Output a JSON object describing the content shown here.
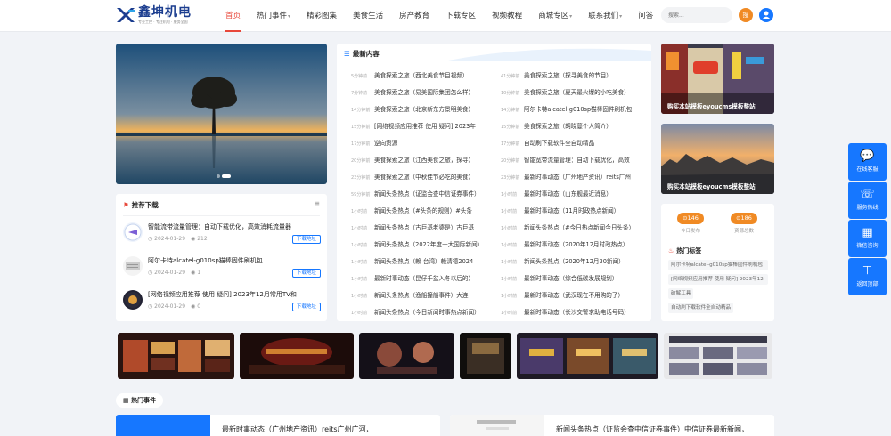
{
  "brand": {
    "title": "鑫坤机电",
    "sub": "专业工控 · 专注机电 · 服务全国"
  },
  "nav": [
    {
      "label": "首页",
      "active": true,
      "caret": false
    },
    {
      "label": "热门事件",
      "caret": true
    },
    {
      "label": "精彩图集",
      "caret": false
    },
    {
      "label": "美食生活",
      "caret": false
    },
    {
      "label": "房产教育",
      "caret": false
    },
    {
      "label": "下载专区",
      "caret": false
    },
    {
      "label": "视频教程",
      "caret": false
    },
    {
      "label": "商城专区",
      "caret": true
    },
    {
      "label": "联系我们",
      "caret": true
    },
    {
      "label": "问答",
      "caret": false
    }
  ],
  "search": {
    "placeholder": "搜索..."
  },
  "header_icons": {
    "orange": "搜",
    "blue": "user-icon"
  },
  "recommend": {
    "title": "推荐下载",
    "btn_label": "下载地址",
    "items": [
      {
        "title": "智能流带流量管理：自动下载优化，高效消耗流量器",
        "date": "2024-01-29",
        "views": "212"
      },
      {
        "title": "阿尔卡特alcatel-g010sp猫棒固件刷机包",
        "date": "2024-01-29",
        "views": "1"
      },
      {
        "title": "[网络视频应用推荐 使用 疑问] 2023年12月常用TV和",
        "date": "2024-01-29",
        "views": "0"
      }
    ]
  },
  "latest": {
    "title": "最新内容",
    "left": [
      {
        "time": "5分钟前",
        "text": "美食探索之旅（西北美食节目视频）"
      },
      {
        "time": "7分钟前",
        "text": "美食探索之旅（易美国际集团怎么样）"
      },
      {
        "time": "14分钟前",
        "text": "美食探索之旅（北京新东方景明美食）"
      },
      {
        "time": "15分钟前",
        "text": "[网络视频应用推荐 使用 疑问] 2023年"
      },
      {
        "time": "17分钟前",
        "text": "逆向资源"
      },
      {
        "time": "20分钟前",
        "text": "美食探索之旅（江西美食之旅，探寻）"
      },
      {
        "time": "23分钟前",
        "text": "美食探索之旅（中秋佳节必吃的美食）"
      },
      {
        "time": "59分钟前",
        "text": "新闻头条热点（证监会查中信证券事件）"
      },
      {
        "time": "1小时前",
        "text": "新闻头条热点（#头条的规则）#头条"
      },
      {
        "time": "1小时前",
        "text": "新闻头条热点（古巨基老婆是）古巨基"
      },
      {
        "time": "1小时前",
        "text": "新闻头条热点（2022年度十大国际新闻）"
      },
      {
        "time": "1小时前",
        "text": "新闻头条热点（赖 台湾）赖清德2024"
      },
      {
        "time": "1小时前",
        "text": "最新时事动态（昆仔千盆入冬以后的）"
      },
      {
        "time": "1小时前",
        "text": "新闻头条热点（渔船撞船事件）大连"
      },
      {
        "time": "1小时前",
        "text": "新闻头条热点（今日新闻时事热点新闻）"
      }
    ],
    "right": [
      {
        "time": "41分钟前",
        "text": "美食探索之旅（探寻美食的节目）"
      },
      {
        "time": "10分钟前",
        "text": "美食探索之旅（夏天最火爆的小吃美食）"
      },
      {
        "time": "14分钟前",
        "text": "阿尔卡特alcatel-g010sp猫棒固件刷机包"
      },
      {
        "time": "15分钟前",
        "text": "美食探索之旅（胡晓蔓个人简介）"
      },
      {
        "time": "17分钟前",
        "text": "自动刷下载软件全自动精品"
      },
      {
        "time": "20分钟前",
        "text": "智能宽带流量管理：自动下载优化，高效"
      },
      {
        "time": "23分钟前",
        "text": "最新时事动态（广州地产资讯）reits广州"
      },
      {
        "time": "1小时前",
        "text": "最新时事动态（山东舰最近消息）"
      },
      {
        "time": "1小时前",
        "text": "最新时事动态（11月时政热点新闻）"
      },
      {
        "time": "1小时前",
        "text": "新闻头条热点（#今日热点新闻今日头条）"
      },
      {
        "time": "1小时前",
        "text": "最新时事动态（2020年12月时政热点）"
      },
      {
        "time": "1小时前",
        "text": "新闻头条热点（2020年12月30新闻）"
      },
      {
        "time": "1小时前",
        "text": "最新时事动态（综合低碳发展规划）"
      },
      {
        "time": "1小时前",
        "text": "最新时事动态（武汉现在不用购的了）"
      },
      {
        "time": "1小时前",
        "text": "最新时事动态（长沙交警求助电话号码）"
      }
    ]
  },
  "side_images": [
    {
      "caption": "购买本站模板eyoucms模板整站"
    },
    {
      "caption": "购买本站模板eyoucms模板整站"
    }
  ],
  "stats": [
    {
      "value": "146",
      "label": "今日发布"
    },
    {
      "value": "186",
      "label": "资源总数"
    }
  ],
  "hot_tags": {
    "title": "热门标签",
    "items": [
      "阿尔卡特alcatel-g010sp猫棒固件刷机包",
      "[网络视频应用推荐 使用 疑问] 2023年12",
      "破解工具",
      "自动刷下载软件全自动精品"
    ]
  },
  "float_bar": [
    {
      "label": "在线客服",
      "icon": "chat-icon"
    },
    {
      "label": "服务热线",
      "icon": "phone-icon"
    },
    {
      "label": "微信咨询",
      "icon": "qrcode-icon"
    },
    {
      "label": "返回顶部",
      "icon": "arrow-up-icon"
    }
  ],
  "hot_events": {
    "title": "热门事件"
  },
  "bottom": [
    {
      "text": "最新时事动态（广州地产资讯）reits广州广河，"
    },
    {
      "text": "新闻头条热点（证监会查中信证券事件）中信证券最新新闻，"
    }
  ],
  "colors": {
    "accent": "#1677ff",
    "active": "#e8473a",
    "orange": "#f08a24"
  }
}
